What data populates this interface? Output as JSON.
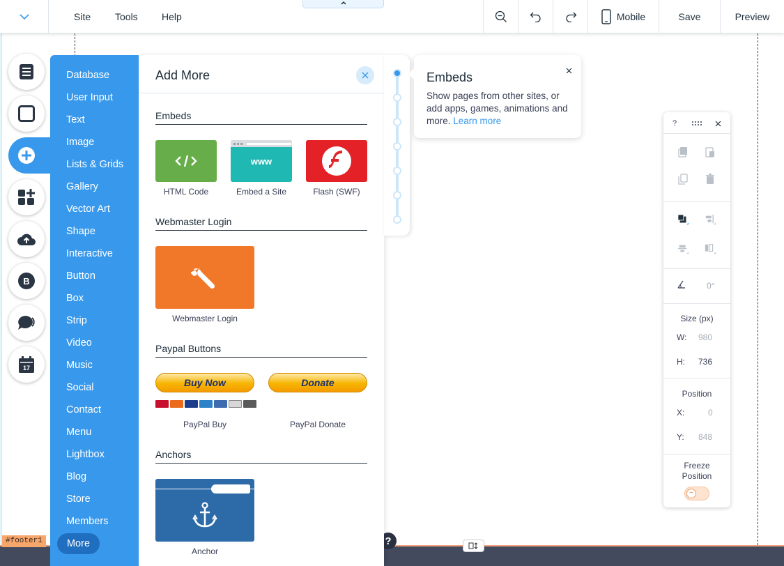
{
  "topbar": {
    "menu": [
      "Site",
      "Tools",
      "Help"
    ],
    "mobile_label": "Mobile",
    "save_label": "Save",
    "preview_label": "Preview"
  },
  "categories": [
    "Database",
    "User Input",
    "Text",
    "Image",
    "Lists & Grids",
    "Gallery",
    "Vector Art",
    "Shape",
    "Interactive",
    "Button",
    "Box",
    "Strip",
    "Video",
    "Music",
    "Social",
    "Contact",
    "Menu",
    "Lightbox",
    "Blog",
    "Store",
    "Members",
    "More"
  ],
  "panel": {
    "title": "Add More",
    "sections": {
      "embeds": {
        "title": "Embeds",
        "items": [
          {
            "label": "HTML Code",
            "icon": "code-icon",
            "color": "#67ad4a"
          },
          {
            "label": "Embed a Site",
            "icon": "www-icon",
            "tile_text": "www",
            "color": "#1fb8b3"
          },
          {
            "label": "Flash (SWF)",
            "icon": "flash-icon",
            "color": "#e32127"
          }
        ]
      },
      "webmaster": {
        "title": "Webmaster Login",
        "items": [
          {
            "label": "Webmaster Login",
            "icon": "wrench-icon",
            "color": "#f07828"
          }
        ]
      },
      "paypal": {
        "title": "Paypal Buttons",
        "buy_now": "Buy Now",
        "donate": "Donate",
        "items": [
          {
            "label": "PayPal Buy"
          },
          {
            "label": "PayPal Donate"
          }
        ]
      },
      "anchors": {
        "title": "Anchors",
        "items": [
          {
            "label": "Anchor",
            "icon": "anchor-icon",
            "color": "#2c6aa8"
          }
        ]
      }
    }
  },
  "tooltip": {
    "title": "Embeds",
    "body": "Show pages from other sites, or add apps, games, animations and more.",
    "link": "Learn more"
  },
  "props": {
    "help": "?",
    "rotation": "0°",
    "size_title": "Size (px)",
    "w_label": "W:",
    "w_value": "980",
    "h_label": "H:",
    "h_value": "736",
    "position_title": "Position",
    "x_label": "X:",
    "x_value": "0",
    "y_label": "Y:",
    "y_value": "848",
    "freeze_title": "Freeze Position"
  },
  "footer": {
    "tag": "#footer1",
    "help": "?"
  },
  "colors": {
    "accent": "#3899ec",
    "accent_dark": "#1f6ebf",
    "footer_strip": "#434a5d",
    "footer_tag": "#f7a66c"
  }
}
